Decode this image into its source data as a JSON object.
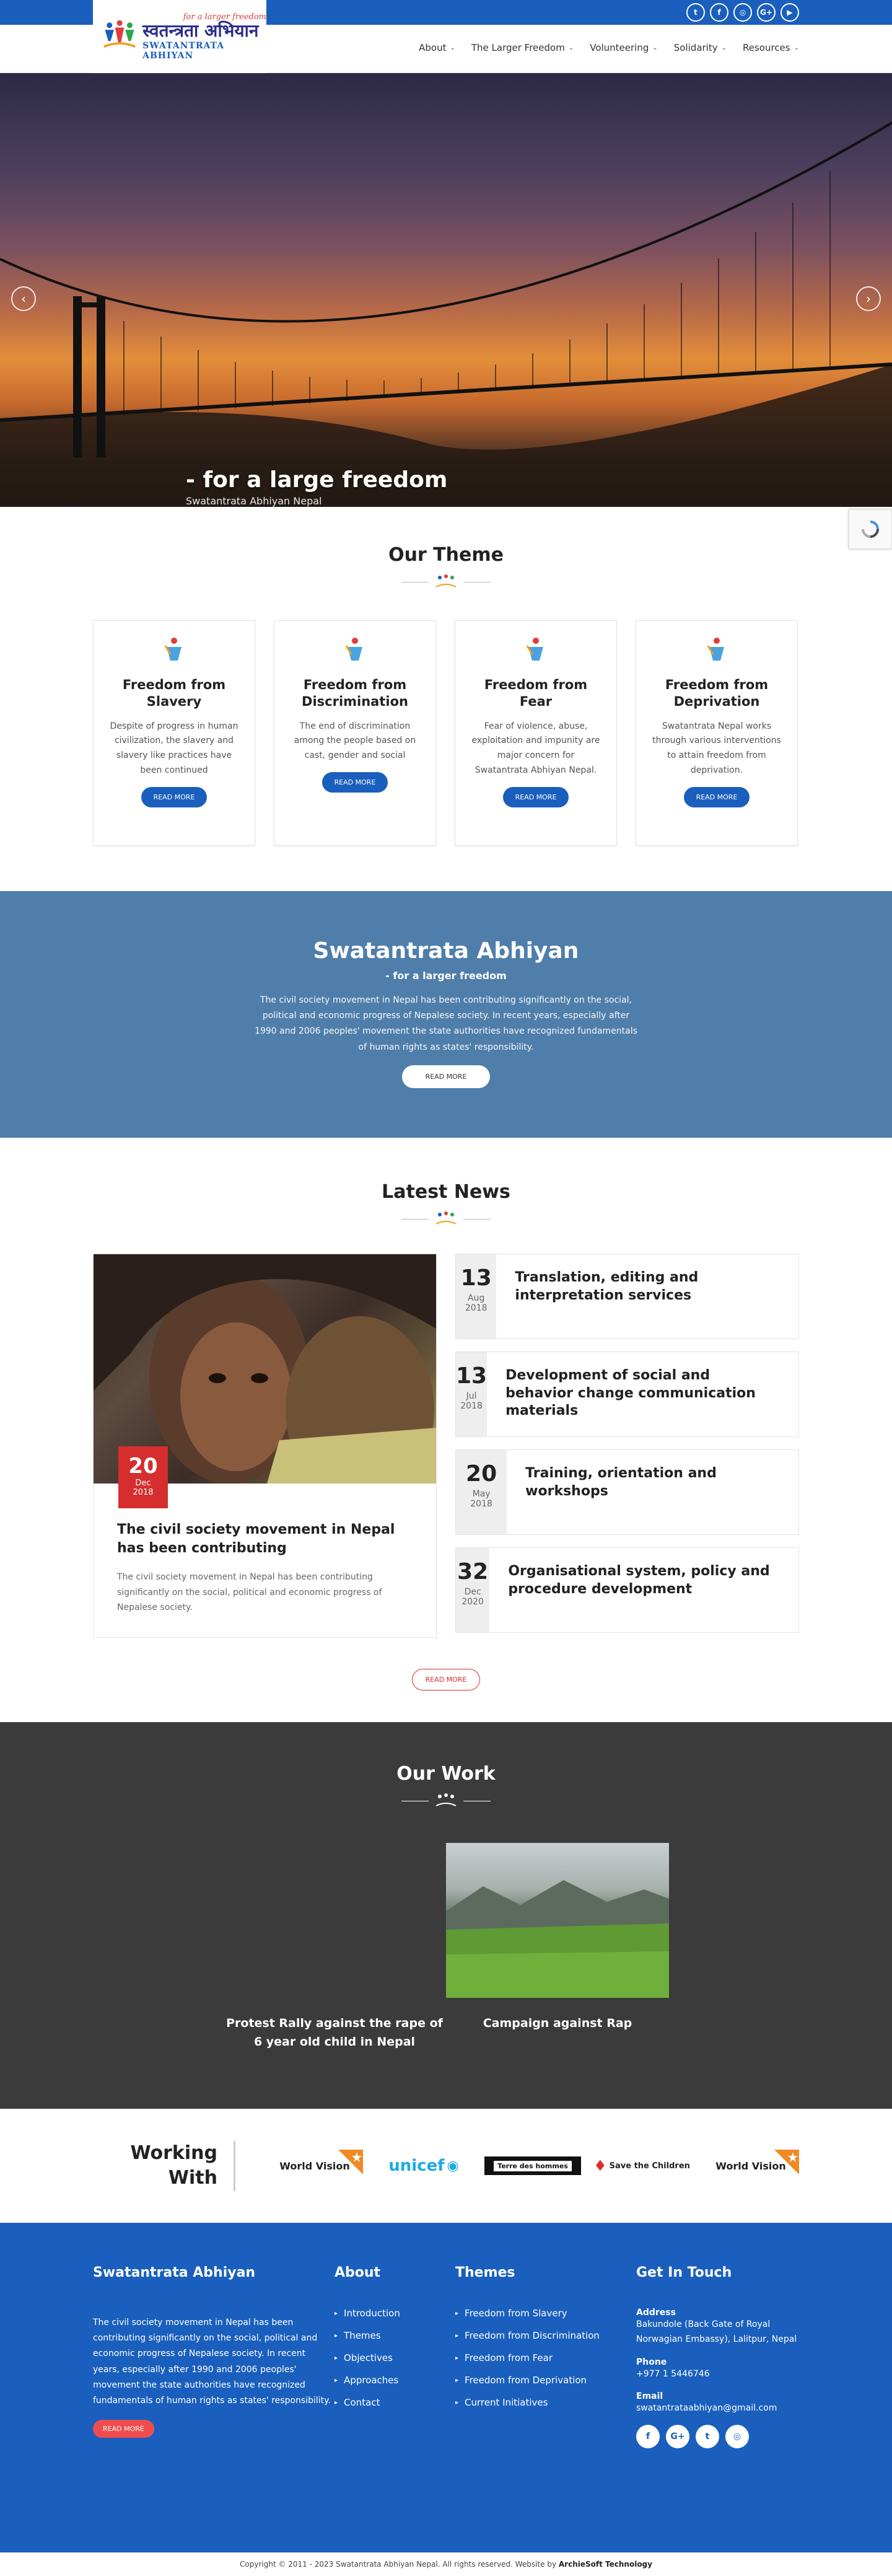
{
  "header": {
    "logo_tagline": "for a larger freedom",
    "logo_devanagari": "स्वतन्त्रता अभियान",
    "logo_english": "SWATANTRATA ABHIYAN",
    "social": [
      "twitter-icon",
      "facebook-icon",
      "instagram-icon",
      "google-plus-icon",
      "youtube-icon"
    ],
    "nav": [
      {
        "label": "About"
      },
      {
        "label": "The Larger Freedom"
      },
      {
        "label": "Volunteering"
      },
      {
        "label": "Solidarity"
      },
      {
        "label": "Resources"
      }
    ]
  },
  "hero": {
    "title": "- for a large freedom",
    "subtitle": "Swatantrata Abhiyan Nepal"
  },
  "theme": {
    "title": "Our Theme",
    "cards": [
      {
        "title": "Freedom from Slavery",
        "text": "Despite of progress in human civilization, the slavery and slavery like practices have been continued",
        "button": "READ MORE"
      },
      {
        "title": "Freedom from Discrimination",
        "text": "The end of discrimination among the people based on cast, gender and social",
        "button": "READ MORE"
      },
      {
        "title": "Freedom from Fear",
        "text": "Fear of violence, abuse, exploitation and impunity are major concern for Swatantrata Abhiyan Nepal.",
        "button": "READ MORE"
      },
      {
        "title": "Freedom from Deprivation",
        "text": "Swatantrata Nepal works through various interventions to attain freedom from deprivation.",
        "button": "READ MORE"
      }
    ]
  },
  "about": {
    "title": "Swatantrata Abhiyan",
    "subtitle": "- for a larger freedom",
    "text": "The civil society movement in Nepal has been contributing significantly on the social, political and economic progress of Nepalese society. In recent years, especially after 1990 and 2006 peoples' movement the state authorities have recognized fundamentals of human rights as states' responsibility.",
    "button": "READ MORE"
  },
  "news": {
    "title": "Latest News",
    "featured": {
      "day": "20",
      "month": "Dec",
      "year": "2018",
      "title": "The civil society movement in Nepal has been contributing",
      "text": "The civil society movement in Nepal has been contributing significantly on the social, political and economic progress of Nepalese society."
    },
    "items": [
      {
        "day": "13",
        "month": "Aug",
        "year": "2018",
        "title": "Translation, editing and interpretation services"
      },
      {
        "day": "13",
        "month": "Jul",
        "year": "2018",
        "title": "Development of social and behavior change communication materials"
      },
      {
        "day": "20",
        "month": "May",
        "year": "2018",
        "title": "Training, orientation and workshops"
      },
      {
        "day": "32",
        "month": "Dec",
        "year": "2020",
        "title": "Organisational system, policy and procedure development"
      }
    ],
    "button": "READ MORE"
  },
  "work": {
    "title": "Our Work",
    "items": [
      {
        "title": "Protest Rally against the rape of 6 year old child in Nepal"
      },
      {
        "title": "Campaign against Rap"
      }
    ]
  },
  "partners": {
    "title": "Working With",
    "logos": [
      "World Vision",
      "unicef",
      "Terre des hommes",
      "Save the Children",
      "World Vision"
    ]
  },
  "footer": {
    "about_title": "Swatantrata Abhiyan",
    "about_text": "The civil society movement in Nepal has been contributing significantly on the social, political and economic progress of Nepalese society. In recent years, especially after 1990 and 2006 peoples' movement the state authorities have recognized fundamentals of human rights as states' responsibility.",
    "about_button": "READ MORE",
    "about_links_title": "About",
    "about_links": [
      "Introduction",
      "Themes",
      "Objectives",
      "Approaches",
      "Contact"
    ],
    "themes_title": "Themes",
    "themes_links": [
      "Freedom from Slavery",
      "Freedom from Discrimination",
      "Freedom from Fear",
      "Freedom from Deprivation",
      "Current Initiatives"
    ],
    "contact_title": "Get In Touch",
    "address_label": "Address",
    "address": "Bakundole (Back Gate of Royal Norwagian Embassy), Lalitpur, Nepal",
    "phone_label": "Phone",
    "phone": "+977 1 5446746",
    "email_label": "Email",
    "email": "swatantrataabhiyan@gmail.com",
    "social": [
      "facebook-icon",
      "google-plus-icon",
      "twitter-icon",
      "instagram-icon"
    ]
  },
  "copyright": {
    "text": "Copyright © 2011 - 2023 Swatantrata Abhiyan Nepal. All rights reserved. Website by",
    "company": "ArchieSoft Technology"
  },
  "colors": {
    "primary": "#1a5fbd",
    "band": "#4f7eab",
    "accent_red": "#d62e2e",
    "dark": "#3b3b3b"
  }
}
